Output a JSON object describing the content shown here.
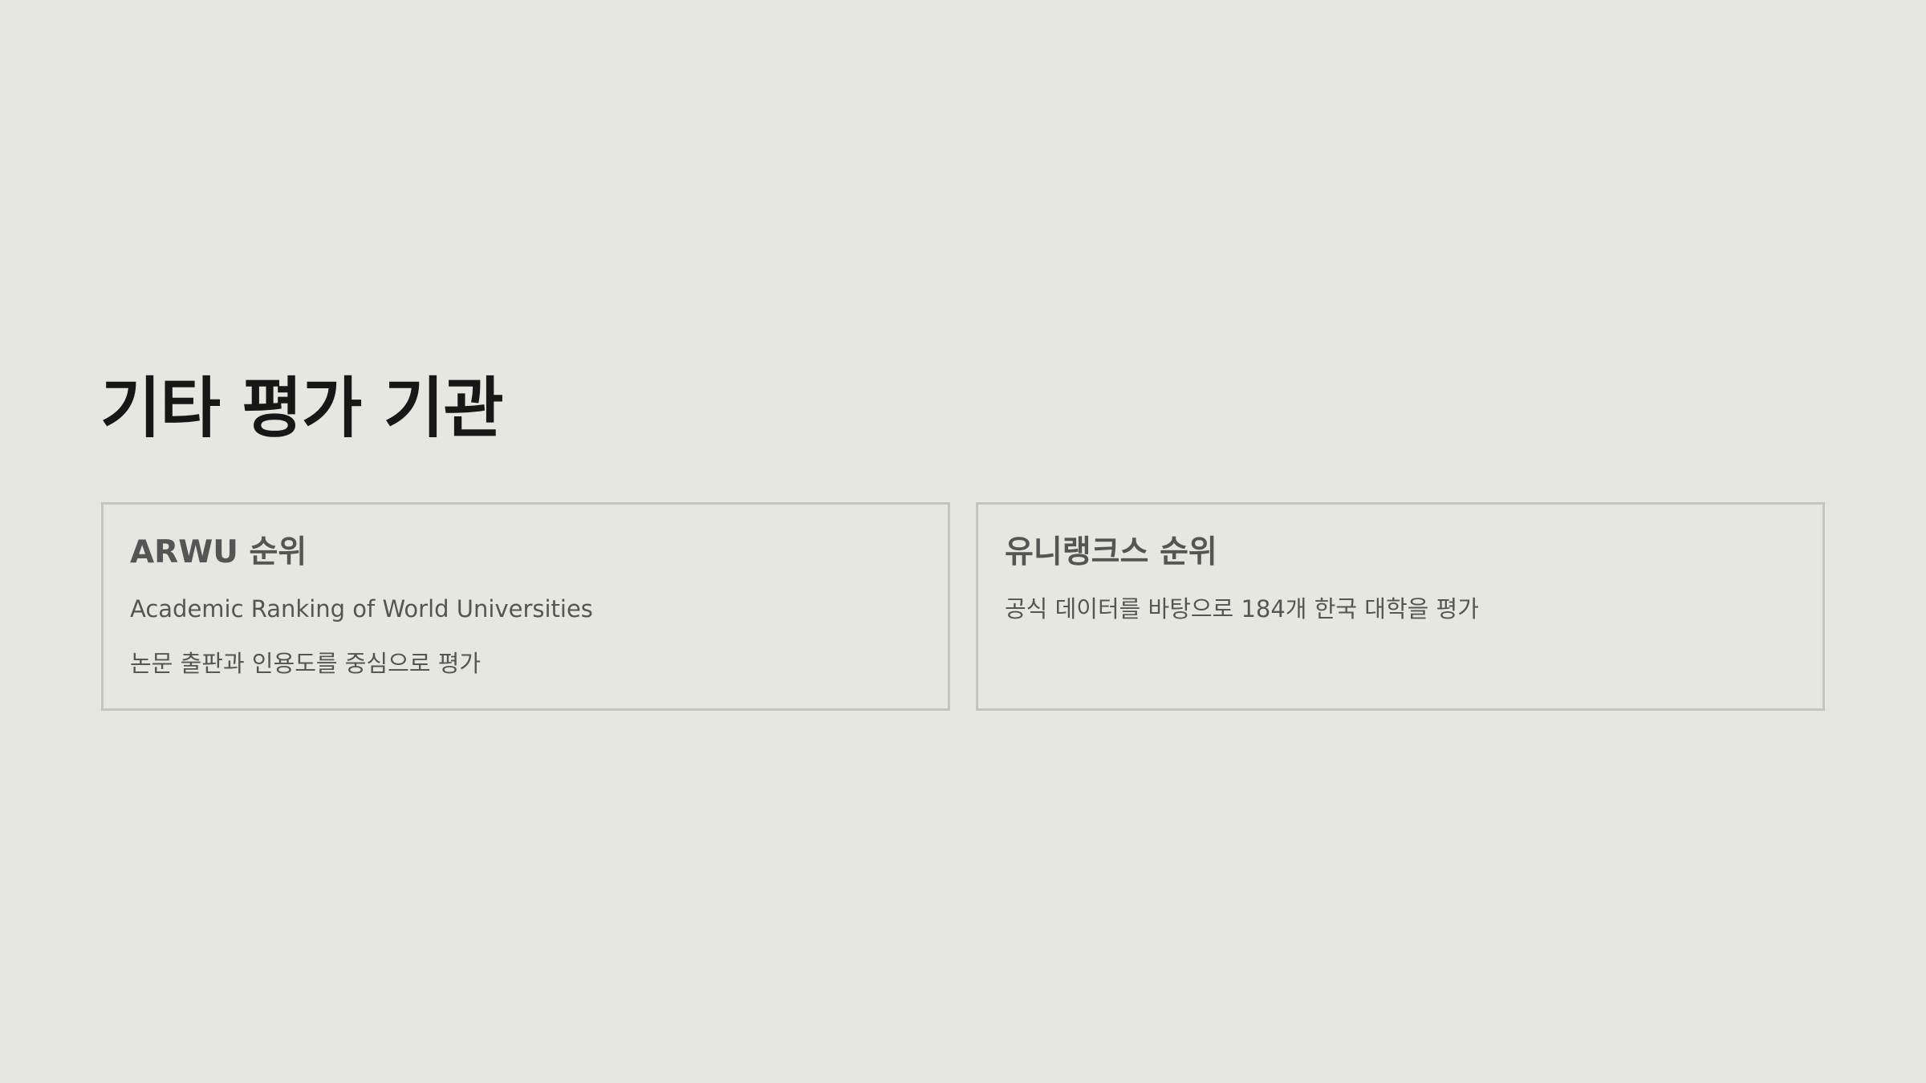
{
  "title": "기타 평가 기관",
  "cards": [
    {
      "title": "ARWU 순위",
      "lines": [
        "Academic Ranking of World Universities",
        "논문 출판과 인용도를 중심으로 평가"
      ]
    },
    {
      "title": "유니랭크스 순위",
      "lines": [
        "공식 데이터를 바탕으로 184개 한국 대학을 평가"
      ]
    }
  ],
  "colors": {
    "background": "#e7e7e1",
    "card_border": "#c5c5c0",
    "title": "#171717",
    "body_text": "#555555"
  }
}
